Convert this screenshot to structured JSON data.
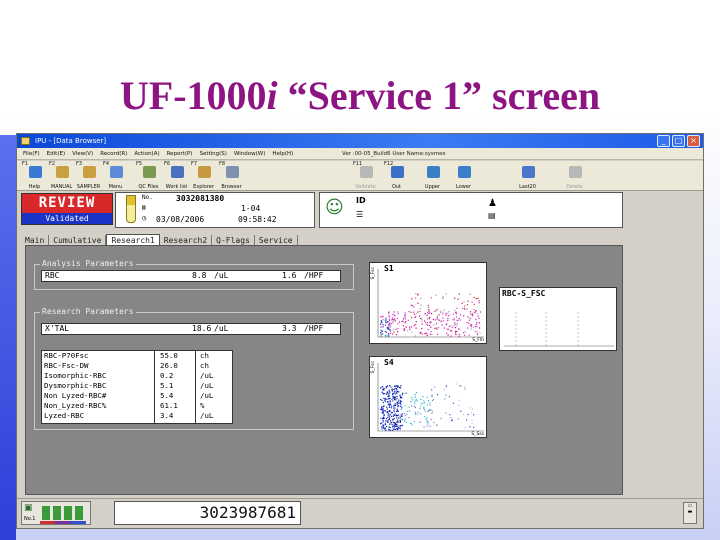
{
  "slide": {
    "title_main": "UF-1000",
    "title_italic": "i",
    "title_rest": " “Service 1” screen"
  },
  "window": {
    "title": "IPU - [Data Browser]",
    "controls": [
      "_",
      "□",
      "×"
    ],
    "menu": [
      "File(F)",
      "Edit(E)",
      "View(V)",
      "Record(R)",
      "Action(A)",
      "Report(P)",
      "Setting(S)",
      "Window(W)",
      "Help(H)"
    ],
    "version_info": "Ver :00-05_Build6 User Name:sysmex"
  },
  "toolbar": [
    {
      "fkey": "F1",
      "label": "Help",
      "color": "#3b78d8",
      "enabled": true
    },
    {
      "fkey": "F2",
      "label": "MANUAL",
      "color": "#c8a040",
      "enabled": true
    },
    {
      "fkey": "F3",
      "label": "SAMPLER",
      "color": "#c8a040",
      "enabled": true
    },
    {
      "fkey": "F4",
      "label": "Menu",
      "color": "#5a8ad8",
      "enabled": true
    },
    {
      "fkey": "F5",
      "label": "QC Files",
      "color": "#7a9a50",
      "enabled": true
    },
    {
      "fkey": "F6",
      "label": "Work list",
      "color": "#4a70c0",
      "enabled": true
    },
    {
      "fkey": "F7",
      "label": "Explorer",
      "color": "#c89840",
      "enabled": true
    },
    {
      "fkey": "F8",
      "label": "Browser",
      "color": "#8090b0",
      "enabled": true
    },
    {
      "fkey": "F11",
      "label": "Validate",
      "color": "#b8b8b8",
      "enabled": false
    },
    {
      "fkey": "F12",
      "label": "Out",
      "color": "#3a70c8",
      "enabled": true
    },
    {
      "fkey": "",
      "label": "Upper",
      "color": "#3a80c8",
      "enabled": true
    },
    {
      "fkey": "",
      "label": "Lower",
      "color": "#3a80c8",
      "enabled": true
    },
    {
      "fkey": "",
      "label": "Last20",
      "color": "#4a78c8",
      "enabled": true
    },
    {
      "fkey": "",
      "label": "Delete",
      "color": "#b8b8b8",
      "enabled": false
    }
  ],
  "status": {
    "review": "REVIEW",
    "validated": "Validated",
    "no_label": "No.",
    "sample_no": "3032081380",
    "rack": "1-04",
    "date": "03/08/2006",
    "time": "09:58:42",
    "id_label": "ID"
  },
  "tabs": [
    "Main",
    "Cumulative",
    "Research1",
    "Research2",
    "Q-Flags",
    "Service"
  ],
  "active_tab": "Research1",
  "analysis": {
    "label": "Analysis Parameters",
    "rows": [
      {
        "name": "RBC",
        "value": "8.8",
        "unit": "/uL",
        "value2": "1.6",
        "unit2": "/HPF"
      }
    ]
  },
  "research": {
    "label": "Research Parameters",
    "top_row": {
      "name": "X'TAL",
      "value": "18.6",
      "unit": "/uL",
      "value2": "3.3",
      "unit2": "/HPF"
    },
    "rows": [
      {
        "name": "RBC-P70Fsc",
        "value": "55.0",
        "unit": "ch"
      },
      {
        "name": "RBC-Fsc-DW",
        "value": "26.0",
        "unit": "ch"
      },
      {
        "name": "Isomorphic-RBC",
        "value": "0.2",
        "unit": "/uL"
      },
      {
        "name": "Dysmorphic-RBC",
        "value": "5.1",
        "unit": "/uL"
      },
      {
        "name": "Non Lyzed-RBC#",
        "value": "5.4",
        "unit": "/uL"
      },
      {
        "name": "Non_Lyzed-RBC%",
        "value": "61.1",
        "unit": "%"
      },
      {
        "name": "Lyzed-RBC",
        "value": "3.4",
        "unit": "/uL"
      }
    ]
  },
  "plots": {
    "s1": {
      "title": "S1",
      "ylabel": "S_Fsc",
      "xlabel": "S_Flh"
    },
    "rbc": {
      "title": "RBC-S_FSC"
    },
    "s4": {
      "title": "S4",
      "ylabel": "S_Fsc",
      "xlabel": "S_Sss"
    }
  },
  "bottom": {
    "big_number": "3023987681",
    "no_label": "No.1"
  }
}
